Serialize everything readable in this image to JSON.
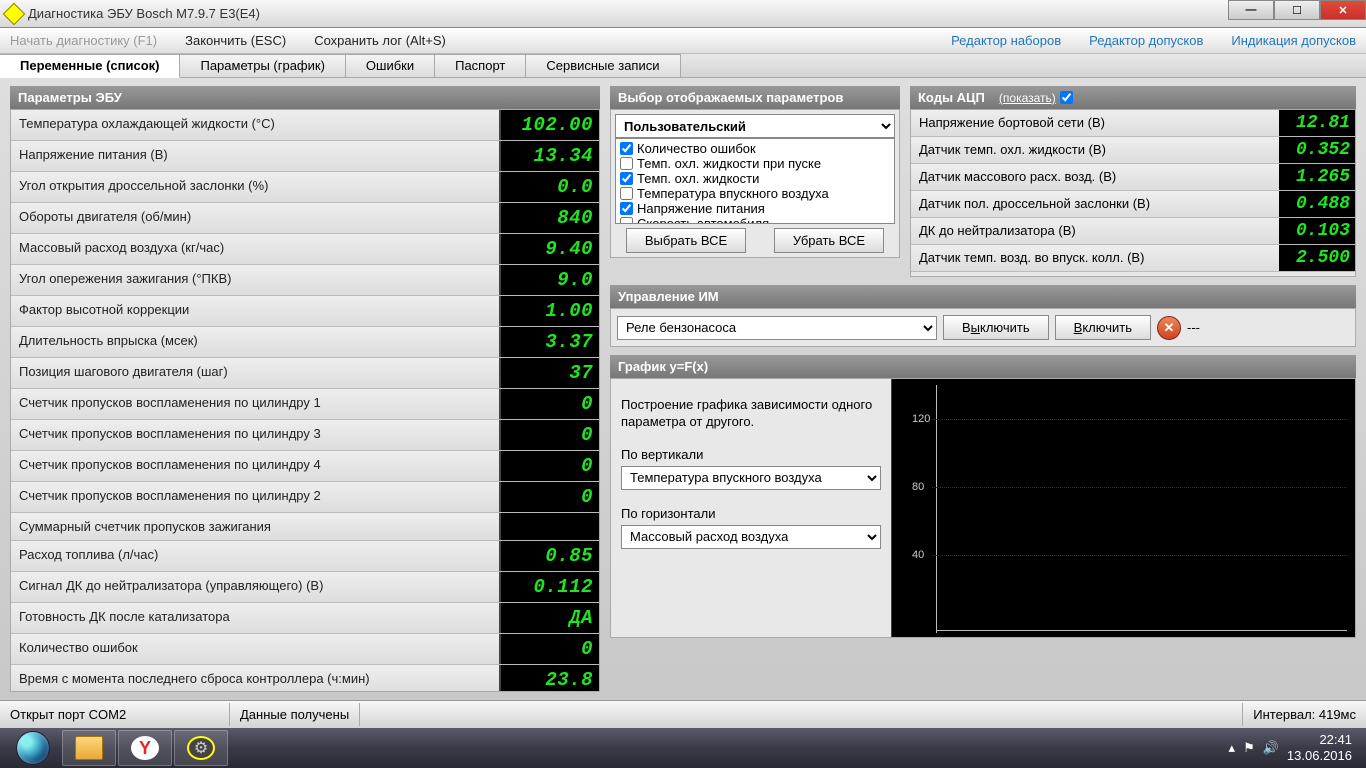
{
  "window": {
    "title": "Диагностика ЭБУ Bosch M7.9.7 E3(E4)"
  },
  "menu": {
    "start": "Начать диагностику (F1)",
    "stop": "Закончить (ESC)",
    "savelog": "Сохранить лог (Alt+S)",
    "seteditor": "Редактор наборов",
    "toleditor": "Редактор допусков",
    "tolindic": "Индикация допусков"
  },
  "tabs": {
    "vars": "Переменные (список)",
    "params": "Параметры (график)",
    "errors": "Ошибки",
    "passport": "Паспорт",
    "service": "Сервисные записи"
  },
  "ecu": {
    "title": "Параметры ЭБУ",
    "rows": [
      {
        "label": "Температура охлаждающей жидкости (°C)",
        "value": "102.00"
      },
      {
        "label": "Напряжение питания (В)",
        "value": "13.34"
      },
      {
        "label": "Угол открытия дроссельной заслонки (%)",
        "value": "0.0"
      },
      {
        "label": "Обороты двигателя (об/мин)",
        "value": "840"
      },
      {
        "label": "Массовый расход воздуха (кг/час)",
        "value": "9.40"
      },
      {
        "label": "Угол опережения зажигания (°ПКВ)",
        "value": "9.0"
      },
      {
        "label": "Фактор высотной коррекции",
        "value": "1.00"
      },
      {
        "label": "Длительность впрыска (мсек)",
        "value": "3.37"
      },
      {
        "label": "Позиция шагового двигателя (шаг)",
        "value": "37"
      },
      {
        "label": "Счетчик пропусков воспламенения по цилиндру 1",
        "value": "0"
      },
      {
        "label": "Счетчик пропусков воспламенения по цилиндру 3",
        "value": "0"
      },
      {
        "label": "Счетчик пропусков воспламенения по цилиндру 4",
        "value": "0"
      },
      {
        "label": "Счетчик пропусков воспламенения по цилиндру 2",
        "value": "0"
      },
      {
        "label": "Суммарный счетчик пропусков зажигания",
        "value": ""
      },
      {
        "label": "Расход топлива (л/час)",
        "value": "0.85"
      },
      {
        "label": "Сигнал ДК до нейтрализатора (управляющего) (В)",
        "value": "0.112"
      },
      {
        "label": "Готовность ДК после катализатора",
        "value": "ДА"
      },
      {
        "label": "Количество ошибок",
        "value": "0"
      },
      {
        "label": "Время с момента последнего сброса контроллера (ч:мин)",
        "value": "23.8"
      }
    ]
  },
  "paramselect": {
    "title": "Выбор отображаемых параметров",
    "preset": "Пользовательский",
    "items": [
      {
        "label": "Количество ошибок",
        "checked": true
      },
      {
        "label": "Темп. охл. жидкости при пуске",
        "checked": false
      },
      {
        "label": "Темп. охл. жидкости",
        "checked": true
      },
      {
        "label": "Температура впускного воздуха",
        "checked": false
      },
      {
        "label": "Напряжение питания",
        "checked": true
      },
      {
        "label": "Скорость автомобиля",
        "checked": false
      }
    ],
    "selectall": "Выбрать ВСЕ",
    "clearall": "Убрать ВСЕ"
  },
  "adc": {
    "title": "Коды АЦП",
    "showlabel": "(показать)",
    "rows": [
      {
        "label": "Напряжение бортовой сети (В)",
        "value": "12.81"
      },
      {
        "label": "Датчик темп. охл. жидкости (В)",
        "value": "0.352"
      },
      {
        "label": "Датчик массового расх. возд. (В)",
        "value": "1.265"
      },
      {
        "label": "Датчик пол. дроссельной заслонки (В)",
        "value": "0.488"
      },
      {
        "label": "ДК до нейтрализатора (В)",
        "value": "0.103"
      },
      {
        "label": "Датчик темп. возд. во впуск. колл. (В)",
        "value": "2.500"
      }
    ]
  },
  "im": {
    "title": "Управление ИМ",
    "device": "Реле бензонасоса",
    "off": "Выключить",
    "on": "Включить",
    "extra": "---"
  },
  "graph": {
    "title": "График y=F(x)",
    "description": "Построение графика зависимости одного параметра от другого.",
    "vlabel": "По вертикали",
    "vselect": "Температура впускного воздуха",
    "hlabel": "По горизонтали",
    "hselect": "Массовый расход воздуха",
    "yticks": [
      "120",
      "80",
      "40"
    ]
  },
  "status": {
    "port": "Открыт порт COM2",
    "data": "Данные получены",
    "interval": "Интервал: 419мс"
  },
  "tray": {
    "time": "22:41",
    "date": "13.06.2016"
  }
}
